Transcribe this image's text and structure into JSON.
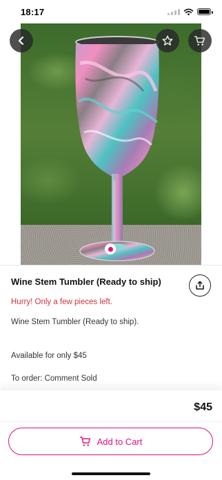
{
  "status_bar": {
    "time": "18:17",
    "icons": [
      "signal-icon",
      "wifi-icon",
      "battery-icon"
    ]
  },
  "hero": {
    "icons": {
      "back": "chevron-left-icon",
      "favorite": "star-icon",
      "cart": "cart-icon"
    },
    "pagination": {
      "current": 1,
      "total": 1
    }
  },
  "product": {
    "title": "Wine Stem Tumbler (Ready to ship)",
    "stock_alert": "Hurry! Only a few pieces left.",
    "description": [
      "Wine Stem Tumbler (Ready to ship).",
      "Available for only $45",
      "To order: Comment Sold"
    ],
    "share_icon": "share-icon"
  },
  "checkout": {
    "price": "$45",
    "add_to_cart_label": "Add to Cart",
    "cart_icon": "cart-icon"
  },
  "colors": {
    "accent": "#e0127d",
    "alert": "#d2323c",
    "overlay_button": "#282828"
  }
}
